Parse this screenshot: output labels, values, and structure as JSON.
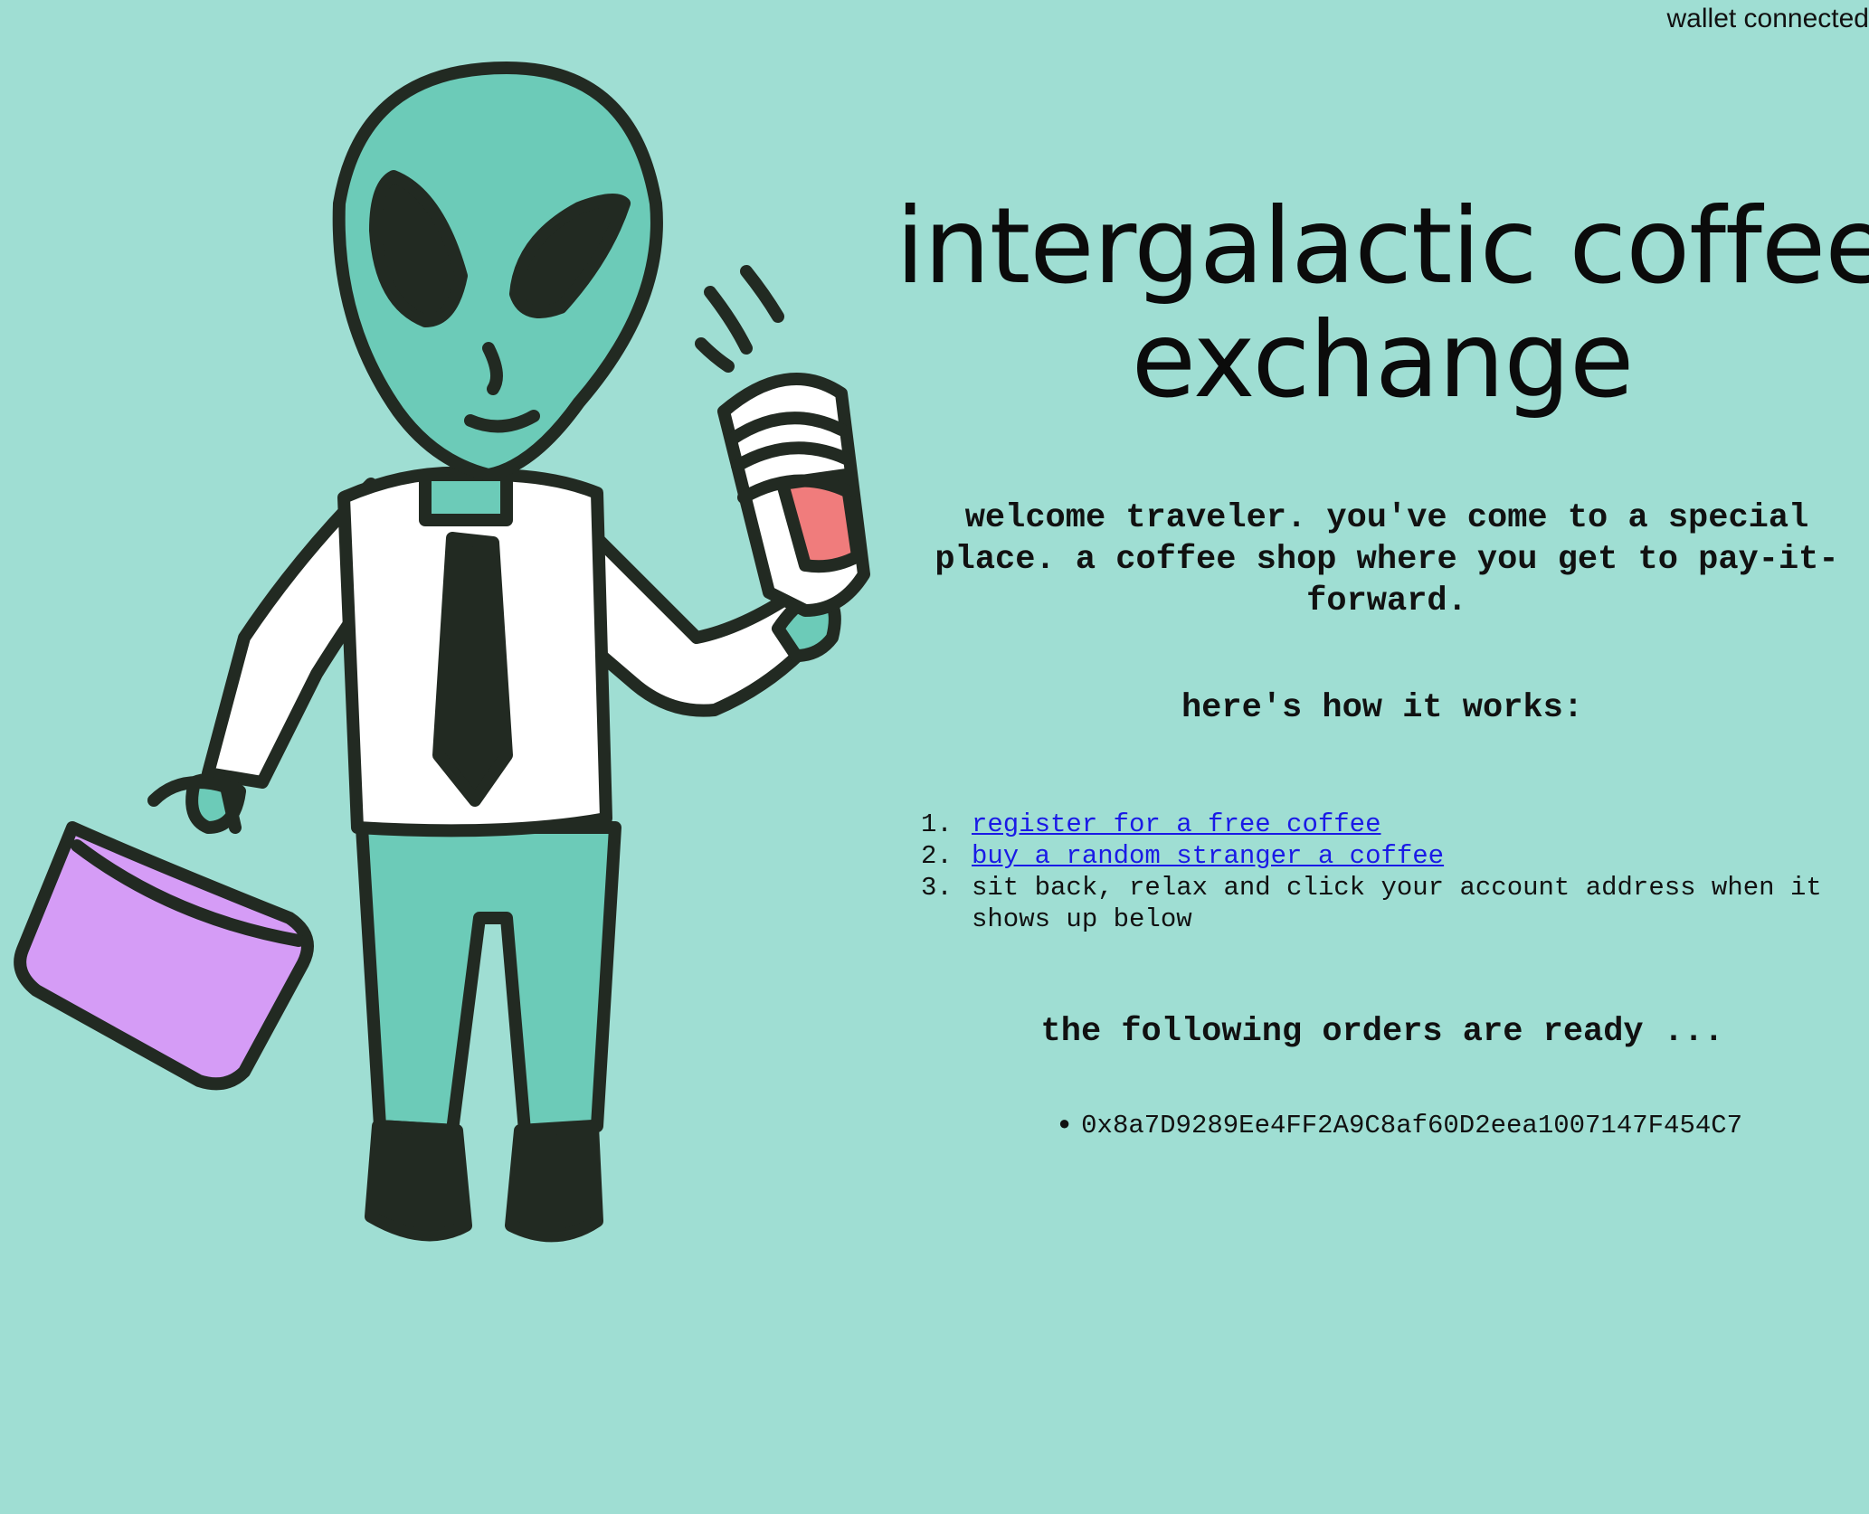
{
  "header": {
    "wallet_status": "wallet connected"
  },
  "illustration": {
    "icon": "alien-with-coffee-and-briefcase-illustration",
    "colors": {
      "skin": "#6ccbb8",
      "outline": "#222a22",
      "shirt": "#ffffff",
      "briefcase": "#d59cf6",
      "cup_accent": "#f07c7c",
      "background": "#9fded3"
    }
  },
  "main": {
    "title_line1": "intergalactic coffee",
    "title_line2": "exchange",
    "welcome": "welcome traveler. you've come to a special place. a coffee shop where you get to pay-it-forward.",
    "how_heading": "here's how it works:",
    "steps": [
      {
        "num": "1.",
        "text": "register for a free coffee"
      },
      {
        "num": "2.",
        "text": "buy a random stranger a coffee"
      },
      {
        "num": "3.",
        "text": "sit back, relax and click your account address when it shows up below"
      }
    ],
    "orders_heading": "the following orders are ready ...",
    "orders": [
      "0x8a7D9289Ee4FF2A9C8af60D2eea1007147F454C7"
    ]
  },
  "theme": {
    "background": "#9fded3",
    "link": "#1a1ae6",
    "text": "#111111"
  }
}
